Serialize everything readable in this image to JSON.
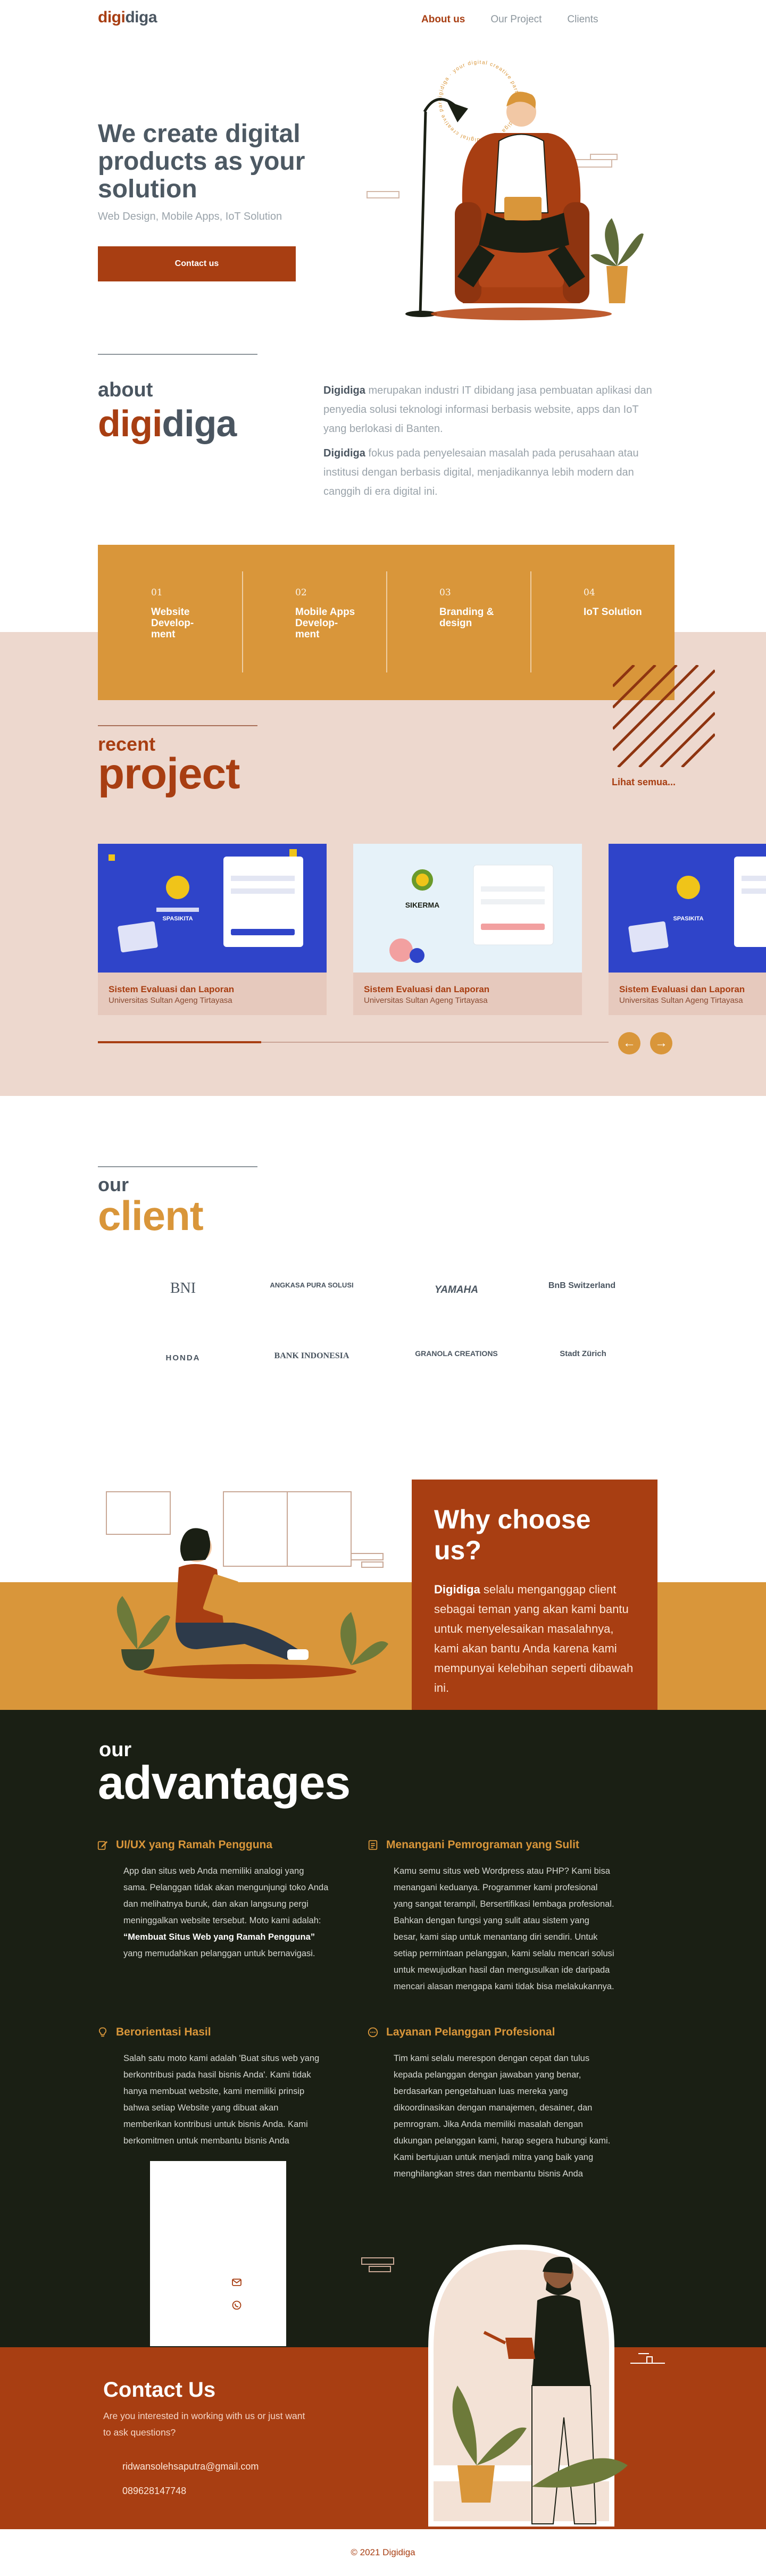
{
  "nav": {
    "logo_a": "digi",
    "logo_b": "diga",
    "links": [
      "About us",
      "Our Project",
      "Clients"
    ]
  },
  "hero": {
    "title": "We create digital products as your solution",
    "subtitle": "Web Design, Mobile Apps, IoT Solution",
    "button": "Contact us",
    "badge": "digidiga · your digital creative partner · digidiga · your digital creative partner"
  },
  "about": {
    "small": "about",
    "big_a": "digi",
    "big_b": "diga",
    "p1_brand": "Digidiga",
    "p1": " merupakan industri IT dibidang jasa pembuatan aplikasi dan penyedia solusi teknologi informasi berbasis website, apps dan IoT  yang berlokasi di Banten.",
    "p2_brand": "Digidiga",
    "p2": " fokus pada penyelesaian masalah pada perusahaan atau institusi dengan berbasis digital, menjadikannya lebih modern dan canggih di era digital ini."
  },
  "services": [
    {
      "num": "01",
      "name": "Website Develop-ment"
    },
    {
      "num": "02",
      "name": "Mobile Apps Develop-ment"
    },
    {
      "num": "03",
      "name": "Branding & design"
    },
    {
      "num": "04",
      "name": "IoT Solution"
    }
  ],
  "projects": {
    "small": "recent",
    "big": "project",
    "see_all": "Lihat semua...",
    "cards": [
      {
        "title": "Sistem Evaluasi dan Laporan",
        "subtitle": "Universitas Sultan Ageng Tirtayasa",
        "logo_text": "SPASIKITA",
        "theme": "blue"
      },
      {
        "title": "Sistem Evaluasi dan Laporan",
        "subtitle": "Universitas Sultan Ageng Tirtayasa",
        "logo_text": "SIKERMA",
        "theme": "light"
      },
      {
        "title": "Sistem Evaluasi dan Laporan",
        "subtitle": "Universitas Sultan Ageng Tirtayasa",
        "logo_text": "SPASIKITA",
        "theme": "blue"
      }
    ],
    "progress_fraction": 0.32,
    "prev": "←",
    "next": "→"
  },
  "clients": {
    "small": "our",
    "big": "client",
    "logos": [
      "BNI",
      "ANGKASA PURA SOLUSI",
      "YAMAHA",
      "BnB Switzerland",
      "HONDA",
      "BANK INDONESIA",
      "GRANOLA CREATIONS",
      "Stadt Zürich"
    ]
  },
  "why": {
    "title": "Why choose us?",
    "brand": "Digidiga",
    "text": " selalu menganggap client sebagai teman yang akan kami bantu untuk menyelesaikan masalahnya, kami akan bantu Anda karena kami mempunyai kelebihan seperti dibawah ini."
  },
  "advantages": {
    "small": "our",
    "big": "advantages",
    "items": [
      {
        "title": "UI/UX yang Ramah Pengguna",
        "icon": "edit-icon",
        "text_a": "App dan situs web Anda memiliki analogi yang sama. Pelanggan tidak akan mengunjungi toko Anda dan melihatnya buruk, dan akan langsung pergi meninggalkan website tersebut. Moto kami adalah: ",
        "bold": "“Membuat Situs Web yang Ramah Pengguna”",
        "text_b": " yang memudahkan pelanggan untuk bernavigasi."
      },
      {
        "title": "Menangani Pemrograman yang Sulit",
        "icon": "code-file-icon",
        "text_a": "Kamu semu situs web Wordpress atau PHP? Kami bisa menangani keduanya. Programmer kami profesional yang sangat terampil, Bersertifikasi lembaga profesional. Bahkan dengan fungsi yang sulit atau sistem yang besar, kami siap untuk menantang diri sendiri. Untuk setiap permintaan pelanggan, kami selalu mencari solusi untuk mewujudkan hasil dan mengusulkan ide daripada mencari alasan mengapa kami tidak bisa melakukannya.",
        "bold": "",
        "text_b": ""
      },
      {
        "title": "Berorientasi Hasil",
        "icon": "lightbulb-icon",
        "text_a": "Salah satu moto kami adalah 'Buat situs web yang berkontribusi pada hasil bisnis Anda'. Kami tidak hanya membuat website, kami memiliki prinsip bahwa setiap Website yang dibuat akan memberikan kontribusi untuk bisnis Anda. Kami berkomitmen untuk membantu bisnis Anda berkembang dan berkembang.",
        "bold": "",
        "text_b": ""
      },
      {
        "title": "Layanan Pelanggan Profesional",
        "icon": "chat-icon",
        "text_a": "Tim kami selalu merespon dengan cepat dan tulus kepada pelanggan dengan jawaban yang benar, berdasarkan pengetahuan luas mereka yang dikoordinasikan dengan manajemen, desainer, dan pemrogram. Jika Anda memiliki masalah dengan dukungan pelanggan kami, harap segera hubungi kami. Kami bertujuan untuk menjadi mitra yang baik yang menghilangkan stres dan membantu bisnis Anda",
        "bold": "",
        "text_b": ""
      }
    ]
  },
  "contact": {
    "title": "Contact Us",
    "question": "Are you interested in working with us or just want to ask questions?",
    "email": "ridwansolehsaputra@gmail.com",
    "phone": "089628147748"
  },
  "footer": {
    "copyright": "© 2021 Digidiga"
  },
  "colors": {
    "brand": "#a83e12",
    "accent": "#d9963a",
    "dark": "#1a1f14",
    "blush": "#edd8ce",
    "text": "#4a5560"
  }
}
